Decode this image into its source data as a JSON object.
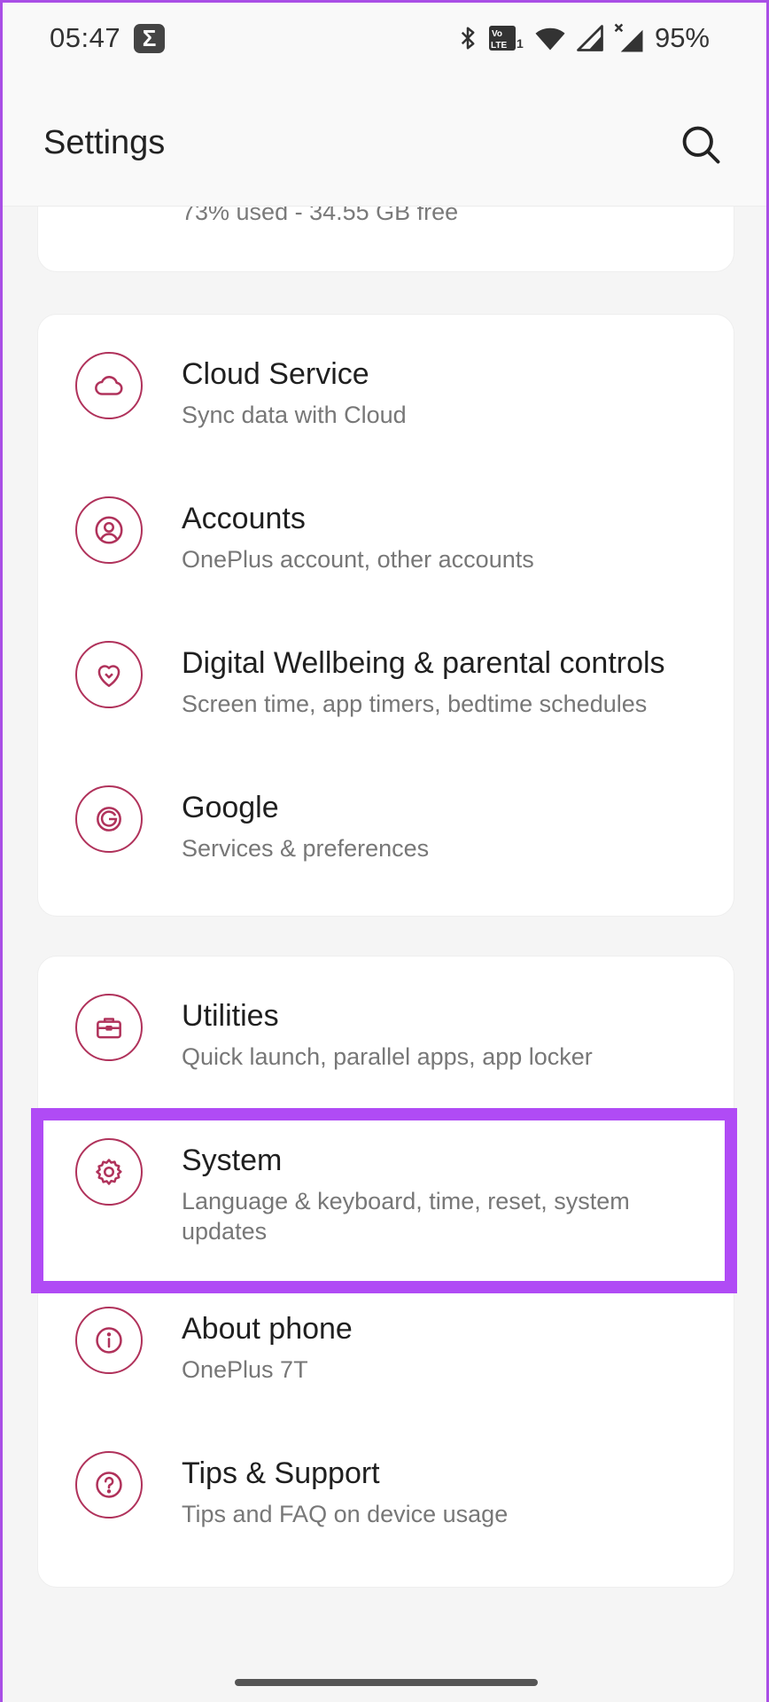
{
  "status_bar": {
    "time": "05:47",
    "notification_badge": "Σ",
    "badge_icon": "sigma-icon",
    "battery_percent": "95%",
    "icons": [
      "bluetooth-icon",
      "volte-icon",
      "wifi-icon",
      "signal-icon",
      "signal-no-service-icon"
    ],
    "volte_label_top": "Vo",
    "volte_label_bottom": "LTE"
  },
  "app_bar": {
    "title": "Settings",
    "search_icon": "search-icon"
  },
  "storage": {
    "subtitle": "73% used - 34.55 GB free"
  },
  "group_1": {
    "items": [
      {
        "title": "Cloud Service",
        "subtitle": "Sync data with Cloud",
        "icon": "cloud-icon"
      },
      {
        "title": "Accounts",
        "subtitle": "OnePlus account, other accounts",
        "icon": "account-icon"
      },
      {
        "title": "Digital Wellbeing & parental controls",
        "subtitle": "Screen time, app timers, bedtime schedules",
        "icon": "heart-icon"
      },
      {
        "title": "Google",
        "subtitle": "Services & preferences",
        "icon": "google-icon"
      }
    ]
  },
  "group_2": {
    "items": [
      {
        "title": "Utilities",
        "subtitle": "Quick launch, parallel apps, app locker",
        "icon": "toolbox-icon"
      },
      {
        "title": "System",
        "subtitle": "Language & keyboard, time, reset, system updates",
        "icon": "gear-icon"
      },
      {
        "title": "About phone",
        "subtitle": "OnePlus 7T",
        "icon": "info-icon"
      },
      {
        "title": "Tips & Support",
        "subtitle": "Tips and FAQ on device usage",
        "icon": "help-icon"
      }
    ]
  },
  "colors": {
    "accent": "#b0325b",
    "highlight": "#b04bf5",
    "frame": "#a94ee6"
  }
}
